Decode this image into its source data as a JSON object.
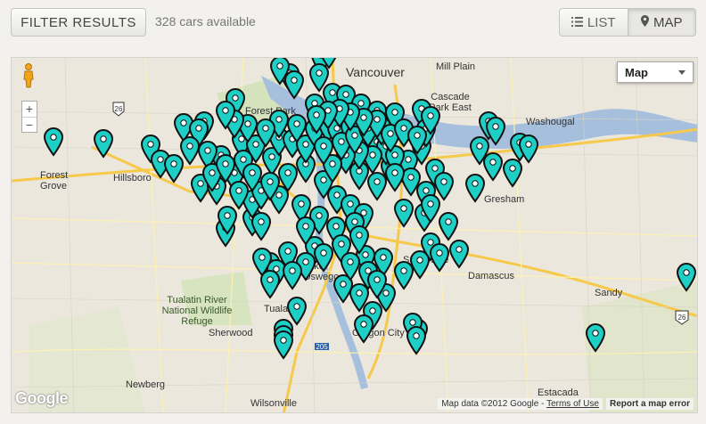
{
  "toolbar": {
    "filter_label": "FILTER RESULTS",
    "count_text": "328 cars available",
    "view_list_label": "LIST",
    "view_map_label": "MAP",
    "active_view": "map"
  },
  "map": {
    "type_selector": "Map",
    "places": [
      {
        "name": "Vancouver",
        "key": "vancouver"
      },
      {
        "name": "Mill Plain",
        "key": "mill_plain"
      },
      {
        "name": "Cascade Park East",
        "key": "cascade_park"
      },
      {
        "name": "Washougal",
        "key": "washougal"
      },
      {
        "name": "Forest Park",
        "key": "forest_park"
      },
      {
        "name": "Forest Grove",
        "key": "forest_grove"
      },
      {
        "name": "Hillsboro",
        "key": "hillsboro"
      },
      {
        "name": "Gresham",
        "key": "gresham"
      },
      {
        "name": "Sunnyside",
        "key": "sunnyside"
      },
      {
        "name": "Damascus",
        "key": "damascus"
      },
      {
        "name": "Sandy",
        "key": "sandy"
      },
      {
        "name": "Lake Oswego",
        "key": "lake_oswego"
      },
      {
        "name": "Tualatin River National Wildlife Refuge",
        "key": "tualatin_refuge"
      },
      {
        "name": "Tualatin",
        "key": "tualatin"
      },
      {
        "name": "Sherwood",
        "key": "sherwood"
      },
      {
        "name": "Oregon City",
        "key": "oregon_city"
      },
      {
        "name": "Newberg",
        "key": "newberg"
      },
      {
        "name": "Wilsonville",
        "key": "wilsonville"
      },
      {
        "name": "Estacada",
        "key": "estacada"
      }
    ],
    "attribution": "Map data ©2012 Google",
    "terms": "Terms of Use",
    "report": "Report a map error",
    "logo": "Google",
    "pin_color": "#1ecfc6",
    "water_color": "#a5bfdd",
    "highway_color": "#f7c94a"
  }
}
